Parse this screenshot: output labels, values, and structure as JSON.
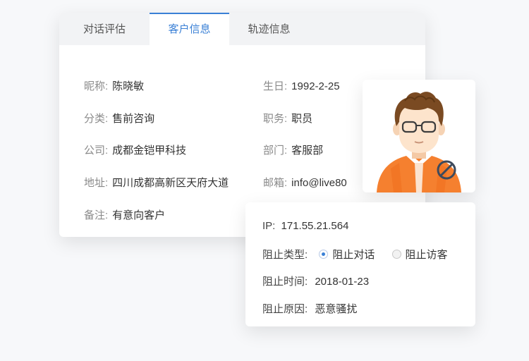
{
  "tabs": [
    {
      "label": "对话评估"
    },
    {
      "label": "客户信息"
    },
    {
      "label": "轨迹信息"
    }
  ],
  "active_tab": "客户信息",
  "customer": {
    "nickname": {
      "label": "昵称:",
      "value": "陈晓敏"
    },
    "category": {
      "label": "分类:",
      "value": "售前咨询"
    },
    "company": {
      "label": "公司:",
      "value": "成都金铠甲科技"
    },
    "address": {
      "label": "地址:",
      "value": "四川成都高新区天府大道"
    },
    "note": {
      "label": "备注:",
      "value": "有意向客户"
    },
    "birthday": {
      "label": "生日:",
      "value": "1992-2-25"
    },
    "position": {
      "label": "职务:",
      "value": "职员"
    },
    "department": {
      "label": "部门:",
      "value": "客服部"
    },
    "email": {
      "label": "邮箱:",
      "value": "info@live80"
    }
  },
  "avatar": {
    "icon": "blocked-user-avatar-icon",
    "badge_icon": "prohibited-icon"
  },
  "block": {
    "ip": {
      "label": "IP:",
      "value": "171.55.21.564"
    },
    "type": {
      "label": "阻止类型:",
      "options": [
        "阻止对话",
        "阻止访客"
      ],
      "selected": "阻止对话"
    },
    "time": {
      "label": "阻止时间:",
      "value": "2018-01-23"
    },
    "reason": {
      "label": "阻止原因:",
      "value": "恶意骚扰"
    }
  },
  "colors": {
    "accent": "#3a80d6",
    "avatar_shirt": "#f5802f",
    "badge": "#3d4a5c"
  }
}
